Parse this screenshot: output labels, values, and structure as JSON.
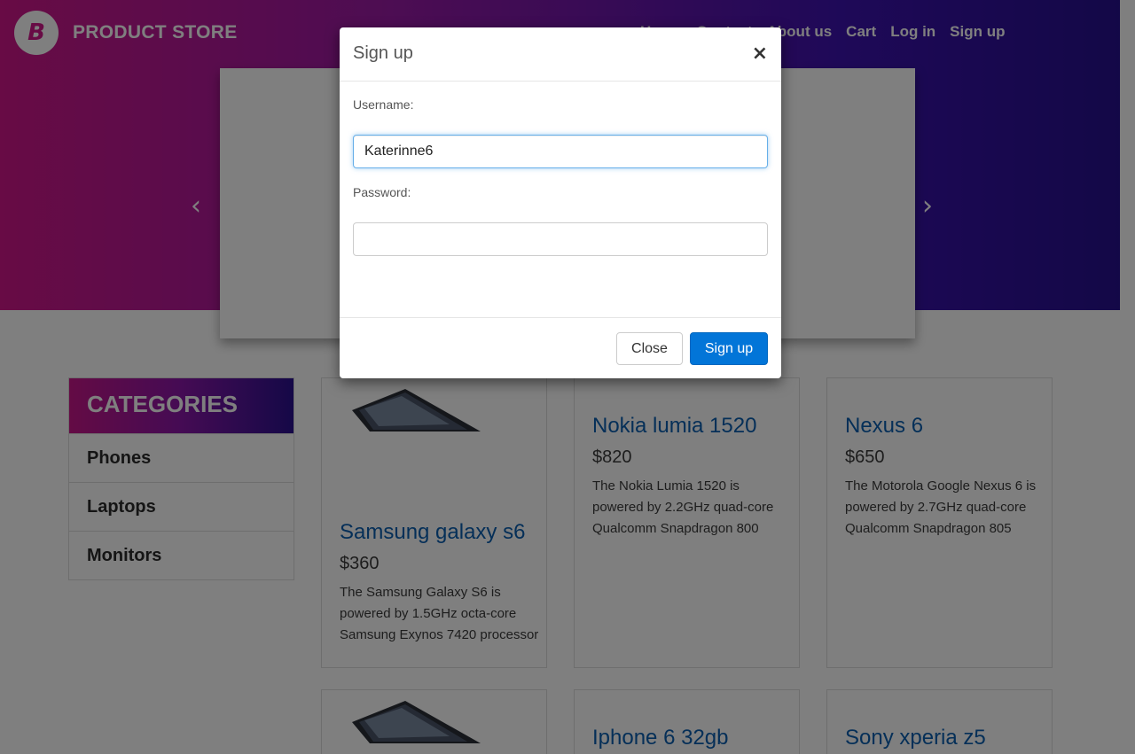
{
  "brand": {
    "logo_letter": "B",
    "name": "PRODUCT STORE"
  },
  "nav": {
    "items": [
      "Home",
      "Contact",
      "About us",
      "Cart",
      "Log in",
      "Sign up"
    ]
  },
  "carousel": {
    "prev_icon": "chevron-left-icon",
    "next_icon": "chevron-right-icon",
    "prev": "‹",
    "next": "›"
  },
  "sidebar": {
    "title": "CATEGORIES",
    "items": [
      "Phones",
      "Laptops",
      "Monitors"
    ]
  },
  "products": [
    {
      "title": "Samsung galaxy s6",
      "price": "$360",
      "desc": "The Samsung Galaxy S6 is powered by 1.5GHz octa-core Samsung Exynos 7420 processor"
    },
    {
      "title": "Nokia lumia 1520",
      "price": "$820",
      "desc": "The Nokia Lumia 1520 is powered by 2.2GHz quad-core Qualcomm Snapdragon 800"
    },
    {
      "title": "Nexus 6",
      "price": "$650",
      "desc": "The Motorola Google Nexus 6 is powered by 2.7GHz quad-core Qualcomm Snapdragon 805"
    },
    {
      "title": "Iphone 6 32gb"
    },
    {
      "title": "Sony xperia z5"
    }
  ],
  "modal": {
    "title": "Sign up",
    "close_icon": "×",
    "username_label": "Username:",
    "username_value": "Katerinne6",
    "password_label": "Password:",
    "password_value": "",
    "close_button": "Close",
    "submit_button": "Sign up"
  },
  "colors": {
    "accent": "#0275d8",
    "brand_pink": "#d0178a",
    "brand_purple": "#27108f",
    "link": "#0a5fb0"
  }
}
